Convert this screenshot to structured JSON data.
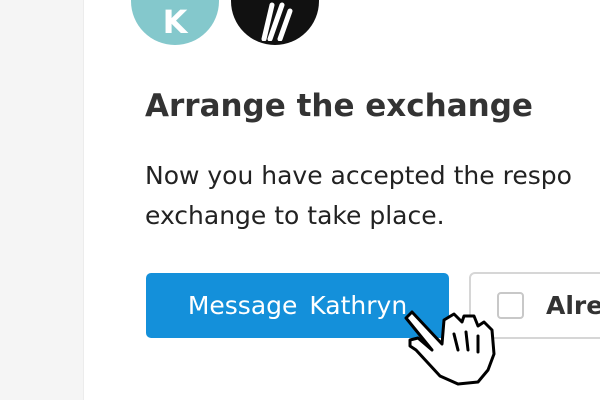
{
  "avatars": [
    {
      "initial": "K",
      "color": "#84c8cc"
    },
    {
      "icon": "pencil-logo-icon",
      "color": "#111111"
    }
  ],
  "heading": "Arrange the exchange",
  "body_text": {
    "line1": "Now you have accepted the respo",
    "line2": "exchange to take place."
  },
  "primary_button": {
    "label": "Message Kathryn",
    "color": "#1490da"
  },
  "secondary_button": {
    "label": "Alre",
    "checked": false
  },
  "cursor": "hand-pointer-icon"
}
